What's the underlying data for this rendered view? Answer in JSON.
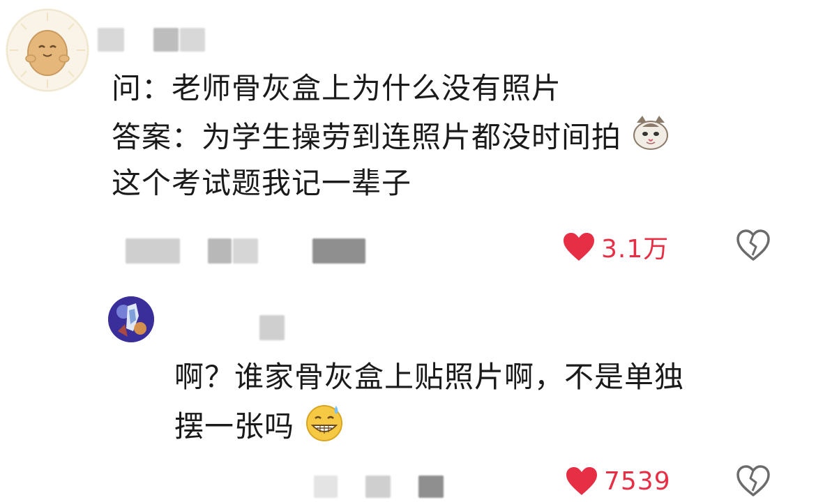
{
  "comment1": {
    "question_line": "问：老师骨灰盒上为什么没有照片",
    "answer_line": "答案：为学生操劳到连照片都没时间拍",
    "tail_line": "这个考试题我记一辈子",
    "likes": "3.1万",
    "emoji_icon": "cat-face-emoji",
    "avatar_icon": "potato-avatar"
  },
  "reply1": {
    "text_line1": "啊？谁家骨灰盒上贴照片啊，不是单独",
    "text_line2": "摆一张吗",
    "likes": "7539",
    "emoji_icon": "grinning-sweat-emoji",
    "avatar_icon": "anime-avatar"
  },
  "colors": {
    "like_red": "#e62e45",
    "text": "#1a1a1a",
    "icon_gray": "#6b6b6b"
  }
}
